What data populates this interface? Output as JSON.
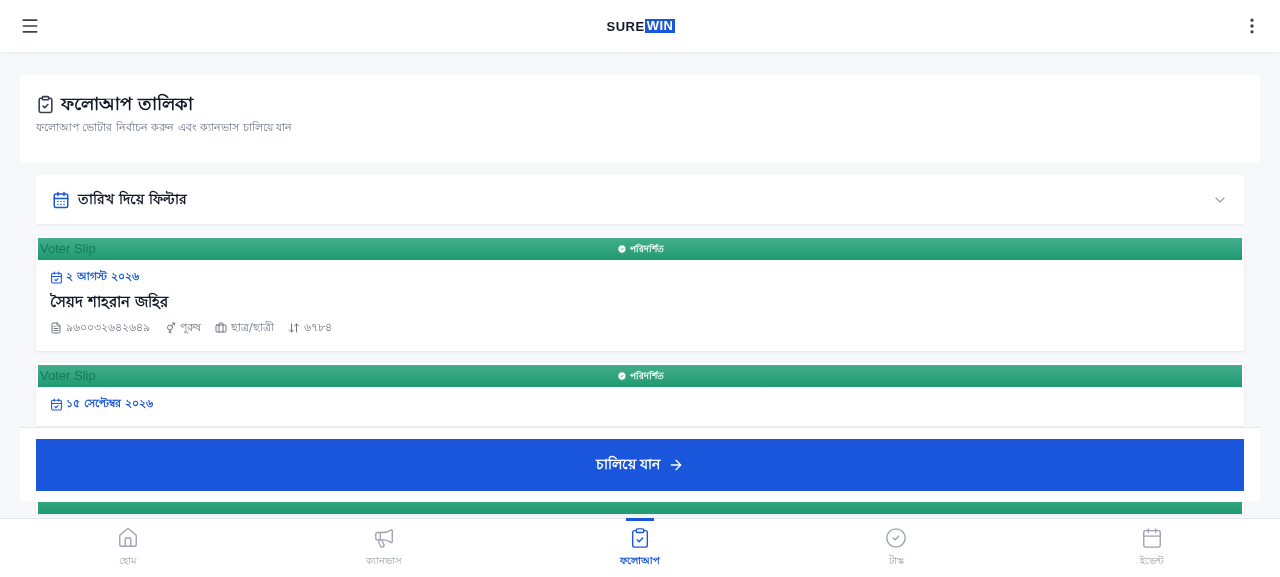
{
  "header": {
    "logo_text": "SURE",
    "logo_highlight": "WIN"
  },
  "page": {
    "title": "ফলোআপ তালিকা",
    "subtitle": "ফলোআপ ভোটার নির্বাচন করুন এবং ক্যানভাস চালিয়ে যান"
  },
  "filter": {
    "label": "তারিখ দিয়ে ফিল্টার",
    "expanded": false
  },
  "cards": [
    {
      "kind": "full",
      "image_alt": "Voter Slip",
      "status": "পরিদর্শিত",
      "date": "২ আগস্ট ২০২৬",
      "name": "সৈয়দ শাহরান জহির",
      "meta": [
        {
          "kind": "id",
          "text": "৯৬০০৩২৬৪২৬৪৯"
        },
        {
          "kind": "gender",
          "text": "পুরুষ"
        },
        {
          "kind": "occupation",
          "text": "ছাত্র/ছাত্রী"
        },
        {
          "kind": "serial",
          "text": "৬৭৮৪"
        }
      ]
    },
    {
      "kind": "full",
      "image_alt": "Voter Slip",
      "status": "পরিদর্শিত",
      "date": "১৫ সেপ্টেম্বর ২০২৬"
    },
    {
      "kind": "banner"
    }
  ],
  "action_button": {
    "label": "চালিয়ে যান"
  },
  "bottom_nav": [
    {
      "kind": "home",
      "label": "হোম",
      "selected": false
    },
    {
      "kind": "canvass",
      "label": "ক্যানভাস",
      "selected": false
    },
    {
      "kind": "followup",
      "label": "ফলোআপ",
      "selected": true
    },
    {
      "kind": "task",
      "label": "টাস্ক",
      "selected": false
    },
    {
      "kind": "event",
      "label": "ইভেন্ট",
      "selected": false
    }
  ]
}
